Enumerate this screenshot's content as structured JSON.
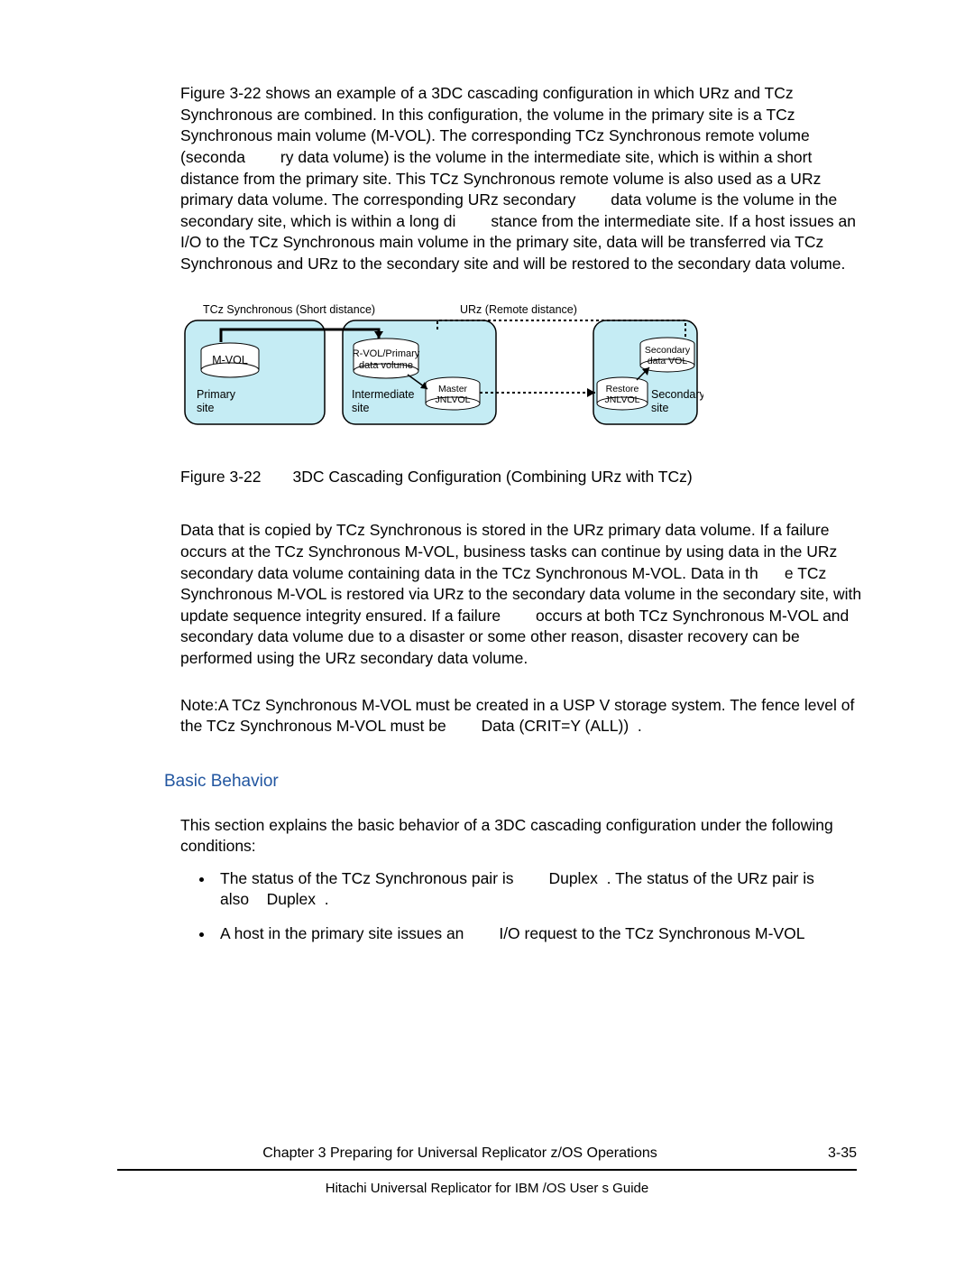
{
  "para1": "Figure 3-22 shows an example of a 3DC cascading configuration in which URz and TCz Synchronous are combined. In this configuration, the volume in the primary site is a TCz Synchronous main volume (M-VOL). The corresponding TCz Synchronous remote volume (seconda    ry data volume) is the volume in the intermediate site, which is within a short distance from the primary site. This TCz Synchronous remote volume is also used as a URz primary data volume. The corresponding URz secondary    data volume is the volume in the secondary site, which is within a long di    stance from the intermediate site. If a host issues an I/O to the TCz Synchronous main volume in the primary site, data will be transferred via TCz Synchronous and URz to the secondary site and will be restored to the secondary data volume.",
  "figure": {
    "tcz_label": "TCz Synchronous (Short distance)",
    "urz_label": "URz (Remote distance)",
    "mvol": "M-VOL",
    "primary_site": "Primary site",
    "rvol": "R-VOL/Primary data volume",
    "intermediate_site": "Intermediate site",
    "master_jnl": "Master JNLVOL",
    "restore_jnl": "Restore JNLVOL",
    "secondary_vol": "Secondary data VOL",
    "secondary_site": "Secondary site"
  },
  "fig_caption": "Figure 3-22  3DC Cascading Configuration (Combining URz with TCz)",
  "para2": "Data that is copied by TCz Synchronous is stored in the URz primary data volume. If a failure occurs at the TCz Synchronous M-VOL, business tasks can continue by using data in the URz secondary data volume containing data in the TCz Synchronous M-VOL. Data in th   e TCz Synchronous M-VOL is restored via URz to the secondary data volume in the secondary site, with update sequence integrity ensured. If a failure    occurs at both TCz Synchronous M-VOL and secondary data volume due to a disaster or some other reason, disaster recovery can be performed using the URz secondary data volume.",
  "note": "Note:A TCz Synchronous M-VOL must be created in a USP V storage system. The fence level of the TCz Synchronous M-VOL must be    Data (CRIT=Y (ALL)) .",
  "heading": "Basic Behavior",
  "para3": "This section explains the basic behavior of a 3DC cascading configuration under the following conditions:",
  "bullets": [
    "The status of the TCz Synchronous pair is    Duplex . The status of the URz pair is also  Duplex .",
    "A host in the primary site issues an    I/O request to the TCz Synchronous M-VOL"
  ],
  "footer": {
    "chapter": "Chapter 3 Preparing for Universal Replicator z/OS Operations",
    "pageno": "3-35",
    "guide": "Hitachi Universal Replicator for IBM /OS User s Guide"
  }
}
